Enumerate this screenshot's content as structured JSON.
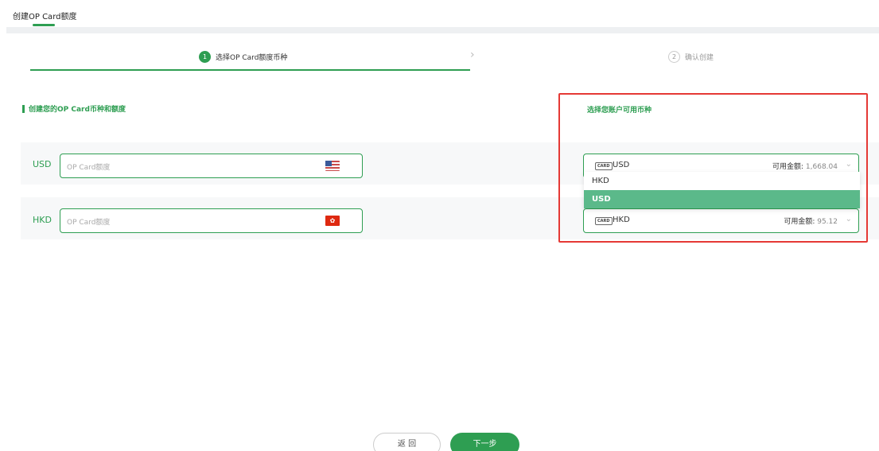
{
  "page": {
    "title": "创建OP Card额度"
  },
  "steps": [
    {
      "number": "1",
      "label": "选择OP Card额度币种",
      "state": "active"
    },
    {
      "number": "2",
      "label": "确认创建",
      "state": "inactive"
    }
  ],
  "left_section": {
    "title": "创建您的OP Card币种和额度"
  },
  "right_section": {
    "title": "选择您账户可用币种"
  },
  "rows": [
    {
      "currency": "USD",
      "placeholder": "OP Card额度",
      "flag": "us-flag-icon"
    },
    {
      "currency": "HKD",
      "placeholder": "OP Card额度",
      "flag": "hk-flag-icon",
      "flag_glyph": "✿"
    }
  ],
  "accounts": [
    {
      "card_label": "CARD",
      "currency": "USD",
      "available_label": "可用金额:",
      "available_value": "1,668.04"
    },
    {
      "card_label": "CARD",
      "currency": "HKD",
      "available_label": "可用金额:",
      "available_value": "95.12"
    }
  ],
  "dropdown": {
    "options": [
      "HKD",
      "USD"
    ],
    "selected": "USD"
  },
  "buttons": {
    "back": "返 回",
    "next": "下一步"
  },
  "colors": {
    "accent": "#2e9e52",
    "dropdown_selected": "#5bb98a",
    "highlight": "#e53935"
  }
}
